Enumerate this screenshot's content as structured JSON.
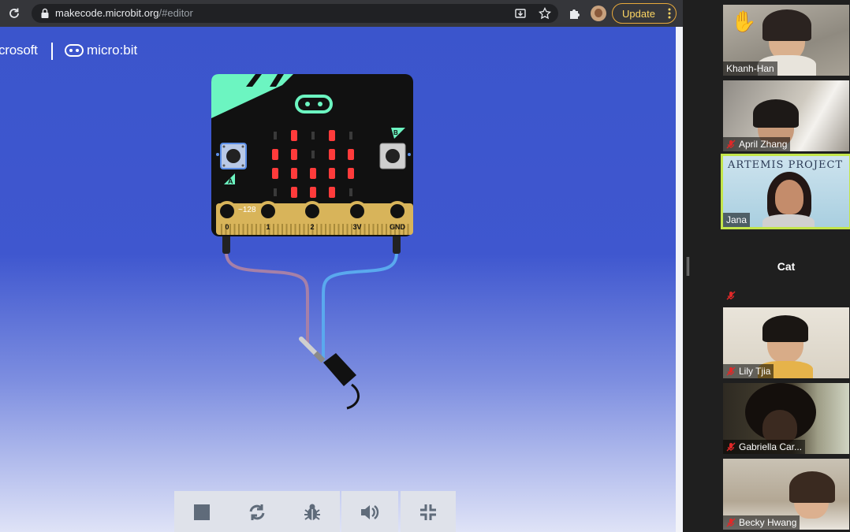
{
  "browser": {
    "url_host": "makecode.microbit.org",
    "url_path": "/#editor",
    "update_label": "Update"
  },
  "header": {
    "ms_brand": "crosoft",
    "mb_brand": "micro:bit"
  },
  "simulator": {
    "pin_labels": [
      "0",
      "1",
      "2",
      "3V",
      "GND"
    ],
    "button_a_label": "A",
    "button_b_label": "B",
    "pin_value_readout": "~128",
    "led_matrix": [
      [
        0,
        1,
        0,
        1,
        0
      ],
      [
        1,
        1,
        0,
        1,
        1
      ],
      [
        1,
        1,
        1,
        1,
        1
      ],
      [
        0,
        1,
        1,
        1,
        0
      ],
      [
        0,
        0,
        1,
        0,
        0
      ]
    ],
    "led_on_color": "#ff3b3b",
    "led_off_color": "#3a3a3a",
    "board_color": "#111111",
    "accent_color": "#6cf5c1",
    "wire_left_color": "#a680a8",
    "wire_right_color": "#5aa9ee",
    "toolbar": [
      {
        "name": "stop",
        "icon": "stop-icon"
      },
      {
        "name": "restart",
        "icon": "restart-icon"
      },
      {
        "name": "debug",
        "icon": "bug-icon"
      },
      {
        "name": "mute",
        "icon": "speaker-icon"
      },
      {
        "name": "fullscreen",
        "icon": "collapse-icon"
      }
    ]
  },
  "zoom": {
    "participants": [
      {
        "name": "Khanh-Han",
        "muted": false,
        "video": true,
        "hand_raised": true
      },
      {
        "name": "April Zhang",
        "muted": true,
        "video": true
      },
      {
        "name": "Jana",
        "muted": false,
        "video": true,
        "active": true,
        "banner": "ARTEMIS PROJECT"
      },
      {
        "name": "Cat",
        "muted": true,
        "video": false
      },
      {
        "name": "Lily Tjia",
        "muted": true,
        "video": true
      },
      {
        "name": "Gabriella Car...",
        "muted": true,
        "video": true
      },
      {
        "name": "Becky Hwang",
        "muted": true,
        "video": true
      }
    ]
  }
}
